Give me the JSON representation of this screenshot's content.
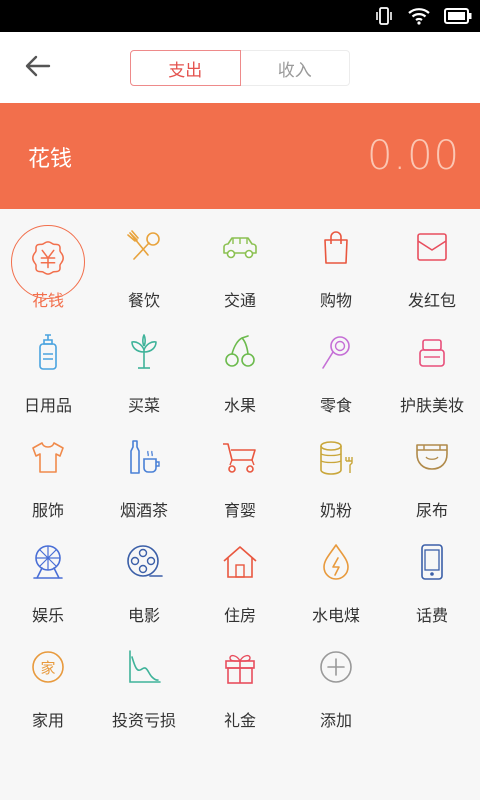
{
  "nav": {
    "tabs": [
      {
        "label": "支出"
      },
      {
        "label": "收入"
      }
    ]
  },
  "banner": {
    "label": "花钱",
    "amount": "0.00"
  },
  "categories": [
    {
      "label": "花钱",
      "icon": "yuan-coin-icon",
      "color": "#f26f4c"
    },
    {
      "label": "餐饮",
      "icon": "fork-spoon-icon",
      "color": "#e8a33d"
    },
    {
      "label": "交通",
      "icon": "car-icon",
      "color": "#8cc152"
    },
    {
      "label": "购物",
      "icon": "shopping-bag-icon",
      "color": "#e9573f"
    },
    {
      "label": "发红包",
      "icon": "envelope-icon",
      "color": "#e84e5e"
    },
    {
      "label": "日用品",
      "icon": "bottle-icon",
      "color": "#4aa3df"
    },
    {
      "label": "买菜",
      "icon": "vegetable-icon",
      "color": "#3fb39a"
    },
    {
      "label": "水果",
      "icon": "cherry-icon",
      "color": "#6dbb4e"
    },
    {
      "label": "零食",
      "icon": "lollipop-icon",
      "color": "#c56fd6"
    },
    {
      "label": "护肤美妆",
      "icon": "cosmetics-icon",
      "color": "#e84e7a"
    },
    {
      "label": "服饰",
      "icon": "tshirt-icon",
      "color": "#f08a4b"
    },
    {
      "label": "烟酒茶",
      "icon": "bottle-cup-icon",
      "color": "#4a80d6"
    },
    {
      "label": "育婴",
      "icon": "stroller-icon",
      "color": "#e9573f"
    },
    {
      "label": "奶粉",
      "icon": "milk-powder-icon",
      "color": "#c9a63a"
    },
    {
      "label": "尿布",
      "icon": "diaper-icon",
      "color": "#b08a4a"
    },
    {
      "label": "娱乐",
      "icon": "ferris-wheel-icon",
      "color": "#4a6fd6"
    },
    {
      "label": "电影",
      "icon": "film-reel-icon",
      "color": "#3b5fa8"
    },
    {
      "label": "住房",
      "icon": "house-icon",
      "color": "#e9573f"
    },
    {
      "label": "水电煤",
      "icon": "energy-drop-icon",
      "color": "#e89a3d"
    },
    {
      "label": "话费",
      "icon": "phone-icon",
      "color": "#3b5fa8"
    },
    {
      "label": "家用",
      "icon": "home-seal-icon",
      "color": "#e89a3d"
    },
    {
      "label": "投资亏损",
      "icon": "stock-chart-icon",
      "color": "#3fb39a"
    },
    {
      "label": "礼金",
      "icon": "gift-box-icon",
      "color": "#e84e5e"
    },
    {
      "label": "添加",
      "icon": "add-circle-icon",
      "color": "#999999"
    }
  ]
}
